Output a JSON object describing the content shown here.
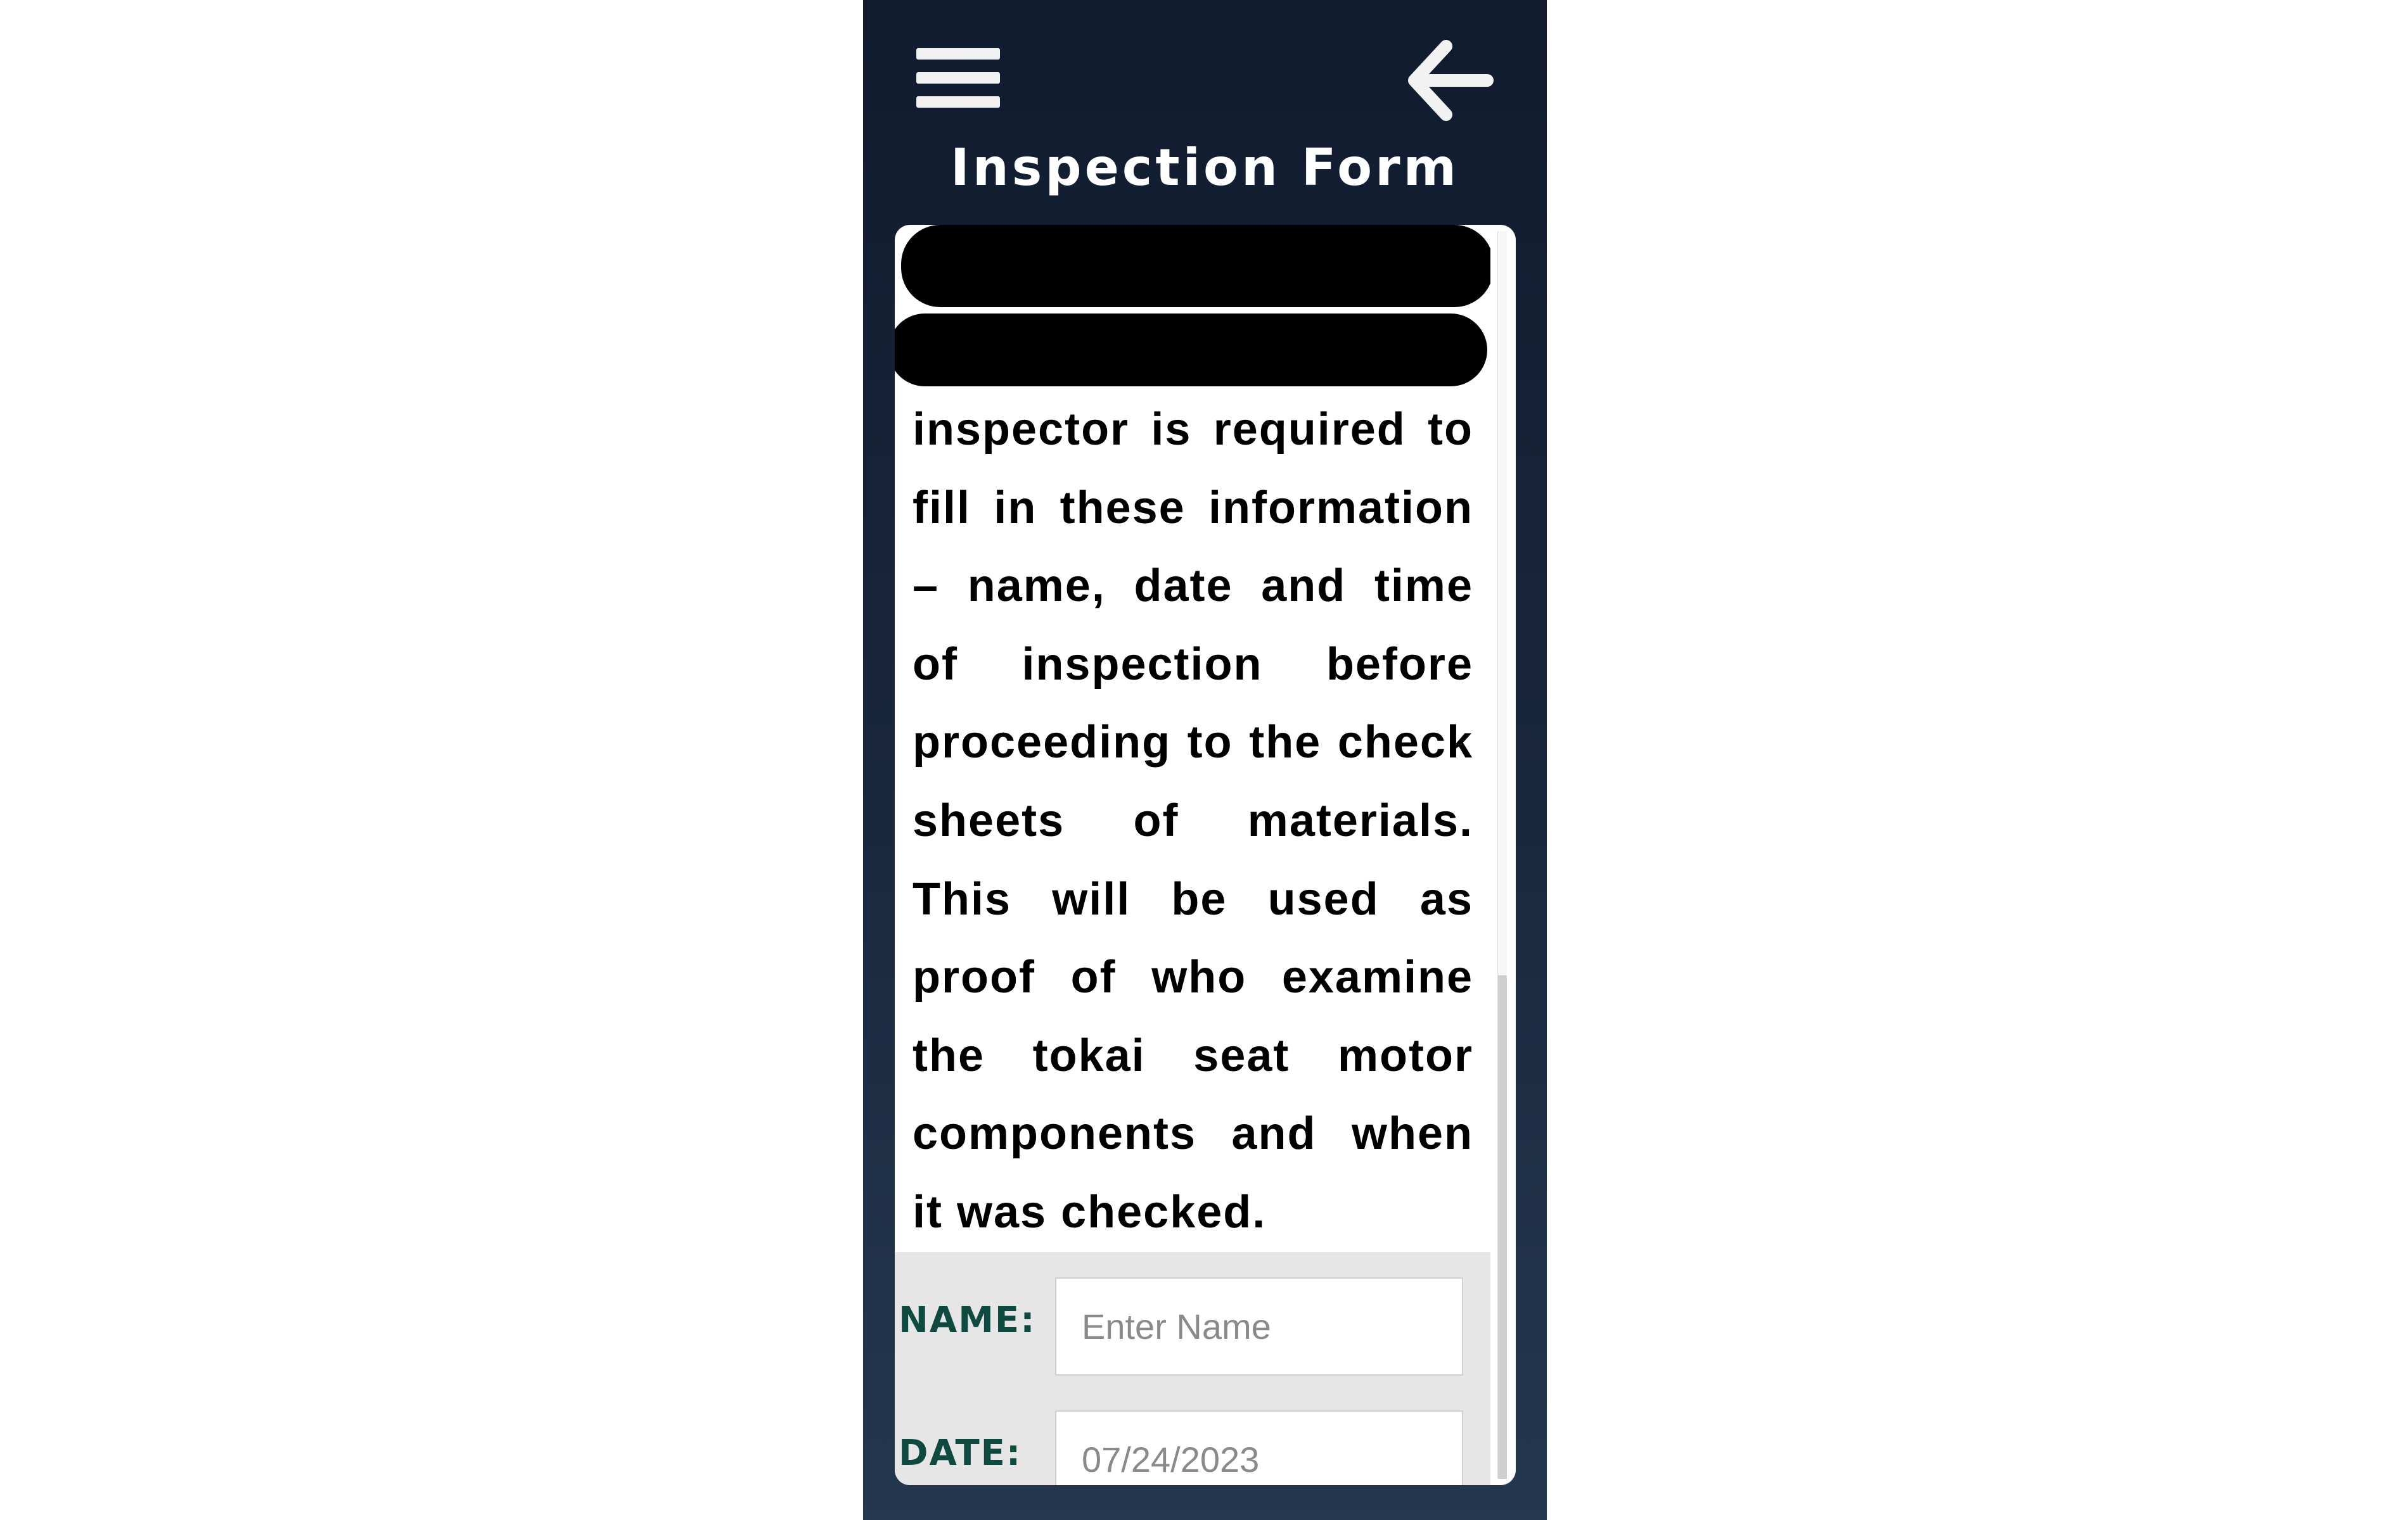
{
  "header": {
    "title": "Inspection Form",
    "menu_icon": "hamburger-menu-icon",
    "back_icon": "arrow-left-icon"
  },
  "content": {
    "description": "inspector is required to fill in these information – name, date and time of inspection before proceeding to the check sheets of materials. This will be used as proof of who examine the tokai seat motor components and when it was checked."
  },
  "form": {
    "name_label": "NAME:",
    "name_placeholder": "Enter Name",
    "date_label": "DATE:",
    "date_value": "07/24/2023"
  },
  "colors": {
    "header_bg": "#101b2e",
    "label": "#0f4a40",
    "redaction": "#000000"
  }
}
